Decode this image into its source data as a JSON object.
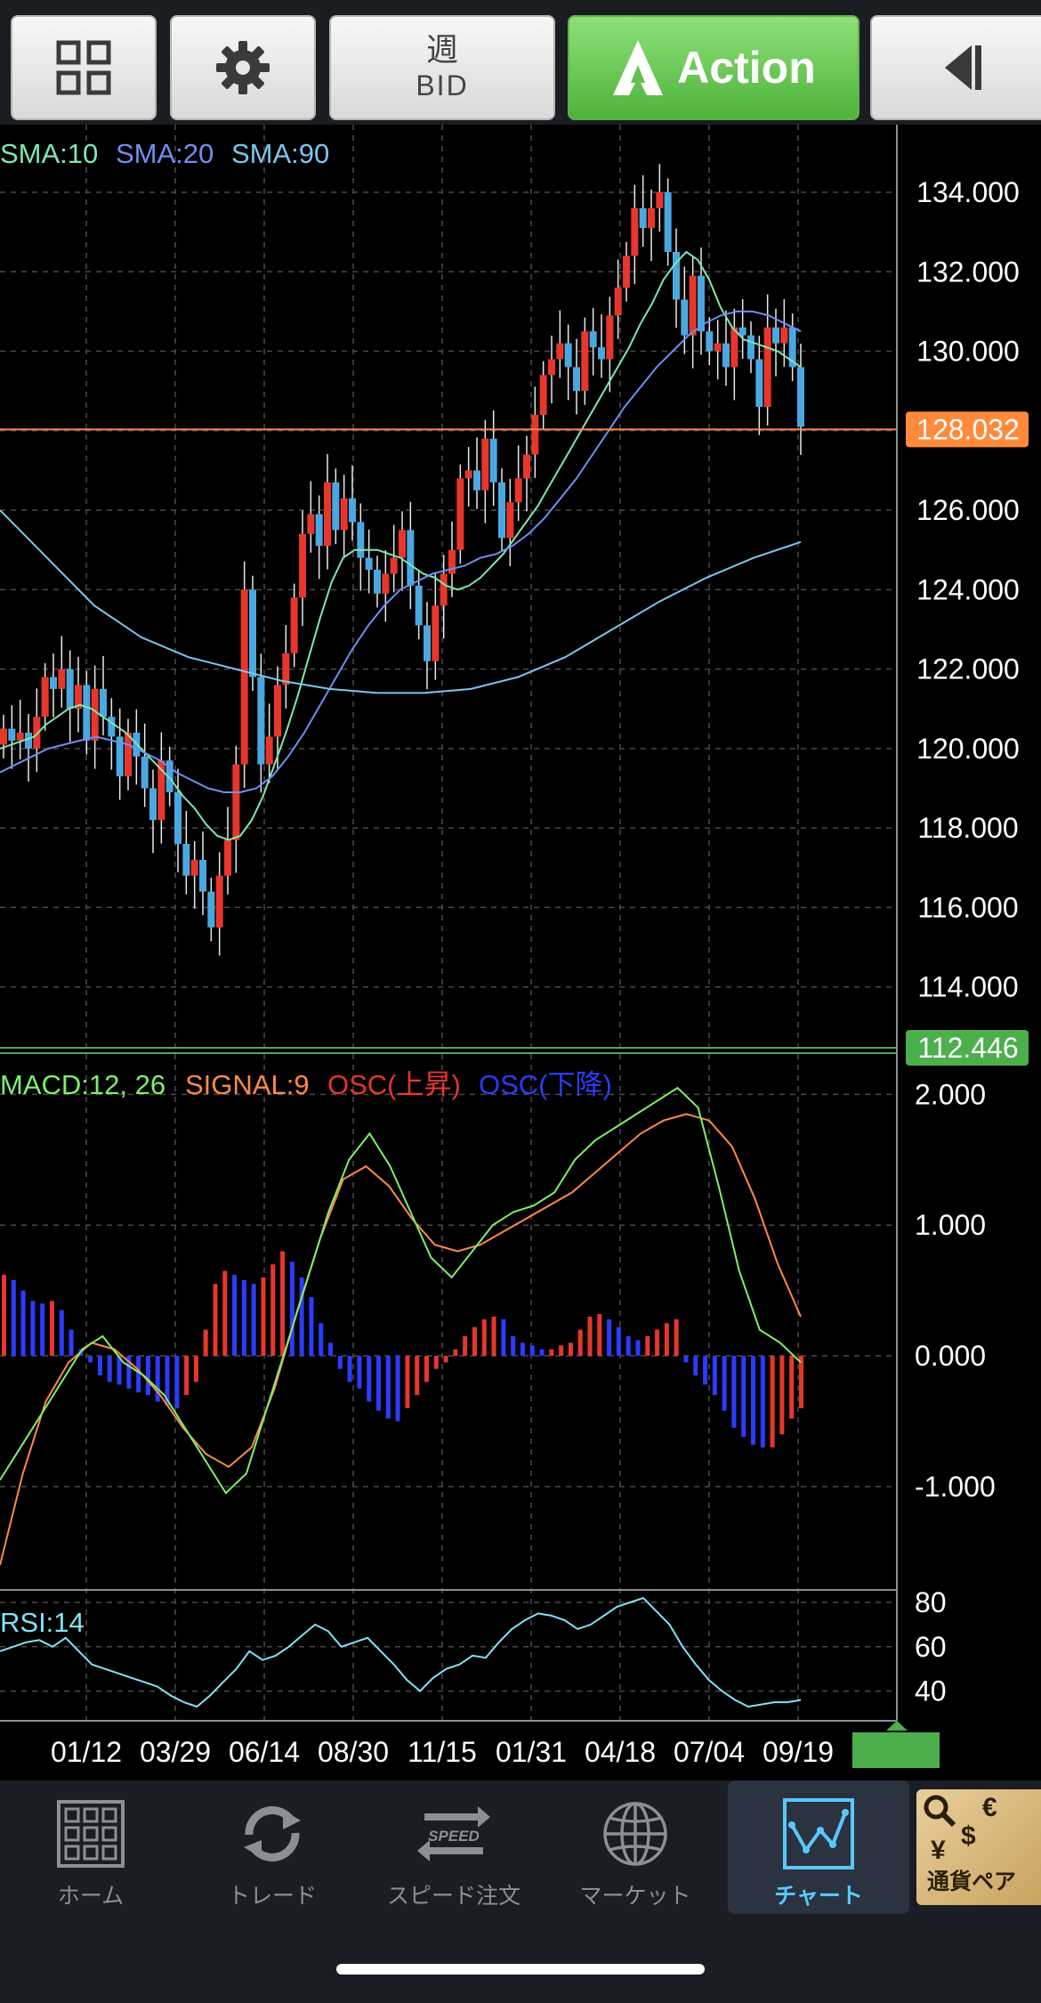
{
  "toolbar": {
    "grid_icon": "grid-icon",
    "gear_icon": "gear-icon",
    "bid_top": "週",
    "bid_bottom": "BID",
    "action_label": "Action",
    "back_icon": "collapse-left-icon"
  },
  "chart_data": [
    {
      "type": "candlestick",
      "legend": [
        "SMA:10",
        "SMA:20",
        "SMA:90"
      ],
      "legend_colors": [
        "#7ee8b0",
        "#6f8ff0",
        "#7cc6ef"
      ],
      "y_ticks": [
        "134.000",
        "132.000",
        "130.000",
        "128.000",
        "126.000",
        "124.000",
        "122.000",
        "120.000",
        "118.000",
        "116.000",
        "114.000"
      ],
      "ylim": [
        112.446,
        135.3
      ],
      "current_price": "128.032",
      "current_price_value": 128.032,
      "low_label": "112.446",
      "up_color": "#e8362c",
      "down_color": "#4aa8e0",
      "closes": [
        120.5,
        120.2,
        120.4,
        120.0,
        120.8,
        121.8,
        121.5,
        122.0,
        121.0,
        121.6,
        120.2,
        121.5,
        120.8,
        120.3,
        119.3,
        120.4,
        119.8,
        119.0,
        118.2,
        119.7,
        118.9,
        117.6,
        116.8,
        117.2,
        116.4,
        115.5,
        116.8,
        117.7,
        119.6,
        124.0,
        121.8,
        119.6,
        120.3,
        121.6,
        122.4,
        123.8,
        125.4,
        125.9,
        125.1,
        126.7,
        125.5,
        126.3,
        125.7,
        124.8,
        124.5,
        123.9,
        124.4,
        124.8,
        125.5,
        124.1,
        123.1,
        122.2,
        123.6,
        124.4,
        125.0,
        126.8,
        127.0,
        126.5,
        127.8,
        126.7,
        125.3,
        126.2,
        126.8,
        127.4,
        128.4,
        129.4,
        129.8,
        130.2,
        129.6,
        129.0,
        130.5,
        130.1,
        129.8,
        130.9,
        131.6,
        132.4,
        133.6,
        133.1,
        133.6,
        134.0,
        132.5,
        131.3,
        130.4,
        131.9,
        130.5,
        130.0,
        130.2,
        129.6,
        130.6,
        130.4,
        129.8,
        128.6,
        130.6,
        130.2,
        130.6,
        129.6,
        128.1
      ],
      "sma10": [
        120.0,
        120.1,
        120.2,
        120.3,
        120.6,
        120.8,
        121.0,
        121.1,
        121.0,
        120.8,
        120.6,
        120.4,
        120.1,
        119.8,
        119.5,
        119.2,
        118.8,
        118.5,
        118.1,
        117.8,
        117.7,
        117.8,
        118.2,
        118.8,
        119.6,
        120.4,
        121.3,
        122.3,
        123.3,
        124.2,
        124.8,
        125.0,
        125.0,
        125.0,
        124.9,
        124.8,
        124.6,
        124.4,
        124.3,
        124.1,
        124.0,
        124.1,
        124.3,
        124.6,
        124.9,
        125.3,
        125.7,
        126.1,
        126.6,
        127.1,
        127.6,
        128.1,
        128.6,
        129.1,
        129.6,
        130.1,
        130.7,
        131.2,
        131.8,
        132.2,
        132.5,
        132.3,
        131.8,
        131.1,
        130.6,
        130.3,
        130.2,
        130.1,
        130.0,
        129.8,
        129.6
      ],
      "sma20": [
        119.4,
        119.6,
        119.8,
        120.0,
        120.1,
        120.2,
        120.3,
        120.2,
        120.1,
        119.9,
        119.7,
        119.4,
        119.2,
        119.0,
        118.9,
        118.9,
        119.0,
        119.3,
        119.8,
        120.4,
        121.1,
        121.8,
        122.5,
        123.1,
        123.6,
        124.0,
        124.2,
        124.4,
        124.5,
        124.6,
        124.8,
        124.9,
        125.1,
        125.4,
        125.8,
        126.3,
        126.8,
        127.4,
        128.0,
        128.6,
        129.1,
        129.6,
        130.0,
        130.4,
        130.7,
        130.9,
        131.0,
        131.0,
        130.9,
        130.7,
        130.5
      ],
      "sma90": [
        126.0,
        124.8,
        123.6,
        122.8,
        122.3,
        122.0,
        121.7,
        121.5,
        121.4,
        121.4,
        121.5,
        121.8,
        122.3,
        123.0,
        123.7,
        124.3,
        124.8,
        125.2
      ]
    },
    {
      "type": "macd",
      "legend": [
        "MACD:12, 26",
        "SIGNAL:9",
        "OSC(上昇)",
        "OSC(下降)"
      ],
      "legend_colors": [
        "#7ef06a",
        "#ff8a45",
        "#e8362c",
        "#2b3cff"
      ],
      "y_ticks": [
        "2.000",
        "1.000",
        "0.000",
        "-1.000"
      ],
      "ylim": [
        -1.75,
        2.2
      ],
      "macd": [
        -0.95,
        -0.7,
        -0.45,
        -0.2,
        0.05,
        0.15,
        -0.05,
        -0.15,
        -0.3,
        -0.55,
        -0.8,
        -1.05,
        -0.9,
        -0.4,
        0.1,
        0.6,
        1.1,
        1.5,
        1.7,
        1.45,
        1.1,
        0.75,
        0.6,
        0.8,
        1.0,
        1.1,
        1.15,
        1.25,
        1.5,
        1.65,
        1.75,
        1.85,
        1.95,
        2.05,
        1.9,
        1.3,
        0.65,
        0.2,
        0.1,
        -0.05
      ],
      "signal": [
        -1.6,
        -0.9,
        -0.35,
        -0.05,
        0.1,
        0.05,
        -0.1,
        -0.3,
        -0.55,
        -0.75,
        -0.85,
        -0.7,
        -0.25,
        0.35,
        0.9,
        1.35,
        1.45,
        1.3,
        1.05,
        0.85,
        0.8,
        0.85,
        0.95,
        1.05,
        1.15,
        1.25,
        1.4,
        1.55,
        1.7,
        1.8,
        1.85,
        1.8,
        1.6,
        1.2,
        0.7,
        0.3
      ],
      "osc": [
        0.62,
        0.58,
        0.5,
        0.42,
        0.4,
        0.42,
        0.35,
        0.2,
        0.05,
        -0.05,
        -0.15,
        -0.2,
        -0.22,
        -0.25,
        -0.28,
        -0.3,
        -0.35,
        -0.38,
        -0.4,
        -0.3,
        -0.2,
        0.2,
        0.55,
        0.65,
        0.62,
        0.58,
        0.55,
        0.6,
        0.7,
        0.8,
        0.72,
        0.6,
        0.45,
        0.25,
        0.1,
        -0.1,
        -0.2,
        -0.25,
        -0.35,
        -0.42,
        -0.48,
        -0.5,
        -0.4,
        -0.3,
        -0.2,
        -0.1,
        -0.05,
        0.05,
        0.15,
        0.22,
        0.28,
        0.3,
        0.28,
        0.15,
        0.1,
        0.08,
        0.05,
        0.05,
        0.08,
        0.1,
        0.2,
        0.3,
        0.32,
        0.28,
        0.22,
        0.15,
        0.12,
        0.15,
        0.2,
        0.25,
        0.28,
        -0.05,
        -0.15,
        -0.22,
        -0.3,
        -0.42,
        -0.55,
        -0.62,
        -0.68,
        -0.7,
        -0.7,
        -0.6,
        -0.48,
        -0.4
      ]
    },
    {
      "type": "line",
      "legend": [
        "RSI:14"
      ],
      "legend_color": "#7fe4f5",
      "y_ticks": [
        "80",
        "60",
        "40"
      ],
      "ylim": [
        27,
        84
      ],
      "rsi": [
        58,
        60,
        62,
        63,
        60,
        64,
        58,
        52,
        50,
        48,
        46,
        44,
        42,
        38,
        35,
        33,
        38,
        44,
        50,
        58,
        54,
        56,
        60,
        65,
        70,
        67,
        60,
        62,
        64,
        58,
        52,
        45,
        40,
        46,
        50,
        52,
        56,
        55,
        62,
        68,
        72,
        75,
        74,
        72,
        68,
        70,
        74,
        78,
        80,
        82,
        76,
        70,
        60,
        52,
        45,
        40,
        36,
        33,
        34,
        35,
        35,
        36
      ]
    }
  ],
  "x_ticks": [
    "01/12",
    "03/29",
    "06/14",
    "08/30",
    "11/15",
    "01/31",
    "04/18",
    "07/04",
    "09/19"
  ],
  "bottom_nav": {
    "home": {
      "label": "ホーム",
      "icon": "home-grid-icon"
    },
    "trade": {
      "label": "トレード",
      "icon": "trade-arrows-icon"
    },
    "speed": {
      "label": "スピード注文",
      "icon": "speed-order-icon",
      "badge": "SPEED"
    },
    "market": {
      "label": "マーケット",
      "icon": "globe-icon"
    },
    "chart": {
      "label": "チャート",
      "icon": "chart-icon"
    },
    "currency": {
      "label": "通貨ペア",
      "icon": "currency-pair-icon",
      "symbols": [
        "€",
        "¥",
        "$"
      ]
    }
  }
}
